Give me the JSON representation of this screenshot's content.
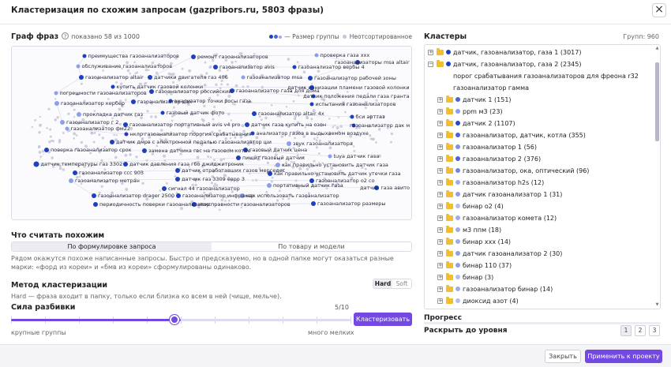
{
  "dialog": {
    "title": "Кластеризация по схожим запросам (gazpribors.ru, 5803 фразы)"
  },
  "graph": {
    "title": "Граф фраз",
    "shown": "показано 58 из 1000",
    "legend_size": "— Размер группы",
    "legend_unsorted": "Неотсортированное",
    "colors": {
      "node": "#1e3fbf",
      "node_light": "#8aa0ee",
      "dot_cloud": "#c3c6d6",
      "edge": "#d3d6e2"
    },
    "nodes": [
      {
        "label": "преимущества газоанализаторов"
      },
      {
        "label": "обслуживание газоанализаторов"
      },
      {
        "label": "газоанализатор altair"
      },
      {
        "label": "датчики двигателя газ 406"
      },
      {
        "label": "ремонт газоанализаторов"
      },
      {
        "label": "проверка газа ххх"
      },
      {
        "label": "газоанализаторы msa altair"
      },
      {
        "label": "газоанализатор avis"
      },
      {
        "label": "газоанализатор вербы 4"
      },
      {
        "label": "газоанализатор msa"
      },
      {
        "label": "газоанализатор рабочей зоны"
      },
      {
        "label": "купить датчик газовой колонки"
      },
      {
        "label": "датчик ионизации пламени газовой колонки"
      },
      {
        "label": "погрешности газоанализаторов"
      },
      {
        "label": "газоанализатор российский"
      },
      {
        "label": "газоанализатор газа для дома"
      },
      {
        "label": "датчик положения педали газа гранта"
      },
      {
        "label": "газоанализатор кербер"
      },
      {
        "label": "газоанализатор дак"
      },
      {
        "label": "анализатор точки росы газа"
      },
      {
        "label": "испытания газоанализаторов"
      },
      {
        "label": "прокладка датчик газ"
      },
      {
        "label": "газовый датчик фото"
      },
      {
        "label": "газоанализатор altair 4x"
      },
      {
        "label": "бси арттаз"
      },
      {
        "label": "газоанализатор г 2"
      },
      {
        "label": "газоанализатор портативный avis v4 pro"
      },
      {
        "label": "датчик газа купить на озон"
      },
      {
        "label": "газоанализатор дак м"
      },
      {
        "label": "газоанализатор фм22"
      },
      {
        "label": "нклр газоанализатор порогия срабатывания"
      },
      {
        "label": "анализатор газов в выдыхаемом воздухе"
      },
      {
        "label": "датчик дмрв с электронной педалью газоанализатор ши"
      },
      {
        "label": "звук газоанализатора"
      },
      {
        "label": "поверка газоанализатор срок"
      },
      {
        "label": "замена датчика гвс на газовом котле"
      },
      {
        "label": "газовый датчик цена"
      },
      {
        "label": "tuya датчик газа"
      },
      {
        "label": "пищит газовый датчик"
      },
      {
        "label": "датчик температуры газ 3302"
      },
      {
        "label": "датчик давления газа гбо джиджитроник"
      },
      {
        "label": "как правильно установить датчик газа"
      },
      {
        "label": "газоанализатор ссс 903"
      },
      {
        "label": "датчик отработавших газов мерседес"
      },
      {
        "label": "как правильно установить датчик утечки газа"
      },
      {
        "label": "газоанализатор метран"
      },
      {
        "label": "датчик газ 3309 евро 3"
      },
      {
        "label": "газоанализатор о2 со"
      },
      {
        "label": "сигнал 44 газоанализатор"
      },
      {
        "label": "портативный датчик газа"
      },
      {
        "label": "датчик газа авито"
      },
      {
        "label": "газоанализатор drager 2500"
      },
      {
        "label": "газоанализатор инфракар"
      },
      {
        "label": "как использовать газоанализатор"
      },
      {
        "label": "периодичность поверки газоанализатор"
      },
      {
        "label": "неисправности газоанализаторов"
      },
      {
        "label": "газоанализатор размеры"
      }
    ]
  },
  "similarity": {
    "title": "Что считать похожим",
    "options": [
      "По формулировке запроса",
      "По товару и модели"
    ],
    "description": "Рядом окажутся похоже написанные запросы. Быстро и предсказуемо, но в одной папке могут оказаться разные марки: «форд из кореи» и «бмв из кореи» сформулированы одинаково."
  },
  "method": {
    "title": "Метод кластеризации",
    "options": [
      "Hard",
      "Soft"
    ],
    "description": "Hard — фраза входит в папку, только если близка ко всем в ней (чище, мельче)."
  },
  "strength": {
    "title": "Сила разбивки",
    "value_label": "5/10",
    "value": 5,
    "max": 10,
    "min_label": "крупные группы",
    "max_label": "много мелких",
    "button": "Кластеризовать"
  },
  "clusters": {
    "title": "Кластеры",
    "count_label": "Групп: 960",
    "items": [
      {
        "label": "датчик, газоанализатор, газа 1 (3017)",
        "level": 0,
        "expand": "+",
        "folder": true,
        "dot": "#1e3fbf"
      },
      {
        "label": "датчик, газоанализатор, газа 2 (2345)",
        "level": 0,
        "expand": "−",
        "folder": true,
        "dot": "#1e3fbf"
      },
      {
        "label": "порог срабатывания газоанализаторов для фреона r32",
        "level": 1,
        "expand": "",
        "folder": false,
        "dot": ""
      },
      {
        "label": "газоанализатор гамма",
        "level": 1,
        "expand": "",
        "folder": false,
        "dot": ""
      },
      {
        "label": "датчик 1 (151)",
        "level": 1,
        "expand": "+",
        "folder": true,
        "dot": "#4a63d9"
      },
      {
        "label": "ppm м3 (23)",
        "level": 1,
        "expand": "+",
        "folder": true,
        "dot": "#8aa0ee"
      },
      {
        "label": "датчик 2 (1107)",
        "level": 1,
        "expand": "+",
        "folder": true,
        "dot": "#2a48c9"
      },
      {
        "label": "газоанализатор, датчик, котла (355)",
        "level": 1,
        "expand": "+",
        "folder": true,
        "dot": "#4a63d9"
      },
      {
        "label": "газоанализатор 1 (56)",
        "level": 1,
        "expand": "+",
        "folder": true,
        "dot": "#7b90e6"
      },
      {
        "label": "газоанализатор 2 (376)",
        "level": 1,
        "expand": "+",
        "folder": true,
        "dot": "#4a63d9"
      },
      {
        "label": "газоанализатор, ока, оптический (96)",
        "level": 1,
        "expand": "+",
        "folder": true,
        "dot": "#6f86e3"
      },
      {
        "label": "газоанализатор h2s (12)",
        "level": 1,
        "expand": "+",
        "folder": true,
        "dot": "#9aabf0"
      },
      {
        "label": "датчик газоанализатор 1 (31)",
        "level": 1,
        "expand": "+",
        "folder": true,
        "dot": "#8aa0ee"
      },
      {
        "label": "бинар о2 (4)",
        "level": 1,
        "expand": "+",
        "folder": true,
        "dot": "#b1bff3"
      },
      {
        "label": "газоанализатор комета (12)",
        "level": 1,
        "expand": "+",
        "folder": true,
        "dot": "#9aabf0"
      },
      {
        "label": "м3 ппм (18)",
        "level": 1,
        "expand": "+",
        "folder": true,
        "dot": "#9aabf0"
      },
      {
        "label": "бинар ххх (14)",
        "level": 1,
        "expand": "+",
        "folder": true,
        "dot": "#9aabf0"
      },
      {
        "label": "датчик газоанализатор 2 (30)",
        "level": 1,
        "expand": "+",
        "folder": true,
        "dot": "#8aa0ee"
      },
      {
        "label": "бинар 110 (37)",
        "level": 1,
        "expand": "+",
        "folder": true,
        "dot": "#8aa0ee"
      },
      {
        "label": "бинар (3)",
        "level": 1,
        "expand": "+",
        "folder": true,
        "dot": "#b1bff3"
      },
      {
        "label": "газоанализатор бинар (14)",
        "level": 1,
        "expand": "+",
        "folder": true,
        "dot": "#9aabf0"
      },
      {
        "label": "диоксид азот (4)",
        "level": 1,
        "expand": "+",
        "folder": true,
        "dot": "#b1bff3"
      }
    ]
  },
  "progress": {
    "title": "Прогресс",
    "value": 0
  },
  "levels": {
    "title": "Раскрыть до уровня",
    "options": [
      "1",
      "2",
      "3"
    ],
    "selected": "1"
  },
  "footer": {
    "close": "Закрыть",
    "apply": "Применить к проекту"
  },
  "accent": "#7349e3"
}
